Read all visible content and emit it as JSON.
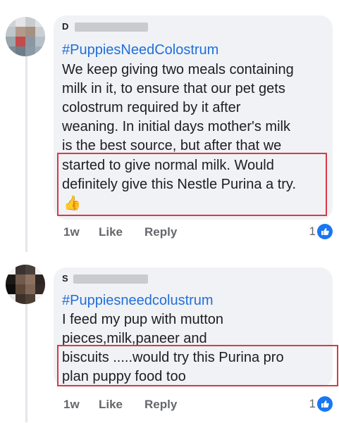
{
  "comments": [
    {
      "author_visible": "D",
      "hashtag": "#PuppiesNeedColostrum",
      "lines": [
        "We keep giving two meals containing",
        "milk in it, to ensure that our pet gets",
        "colostrum required by it after",
        "weaning. In initial days mother's milk",
        "is the best source, but after that we",
        "started to give normal milk. Would",
        "definitely give this Nestle Purina a try."
      ],
      "emoji": "👍",
      "time": "1w",
      "like_label": "Like",
      "reply_label": "Reply",
      "reaction_count": "1"
    },
    {
      "author_visible": "S",
      "hashtag": "#Puppiesneedcolustrum",
      "lines": [
        "I feed my pup with mutton",
        "pieces,milk,paneer and",
        "biscuits .....would try this Purina pro",
        "plan puppy food too"
      ],
      "time": "1w",
      "like_label": "Like",
      "reply_label": "Reply",
      "reaction_count": "1"
    }
  ],
  "colors": {
    "bubble": "#f0f2f5",
    "hashtag": "#216fdb",
    "highlight_box": "#d93a45",
    "meta_text": "#65676b",
    "like_blue": "#1877f2"
  },
  "icons": {
    "reaction": "thumbs-up-like-icon",
    "emoji": "thumbs-up-emoji"
  }
}
